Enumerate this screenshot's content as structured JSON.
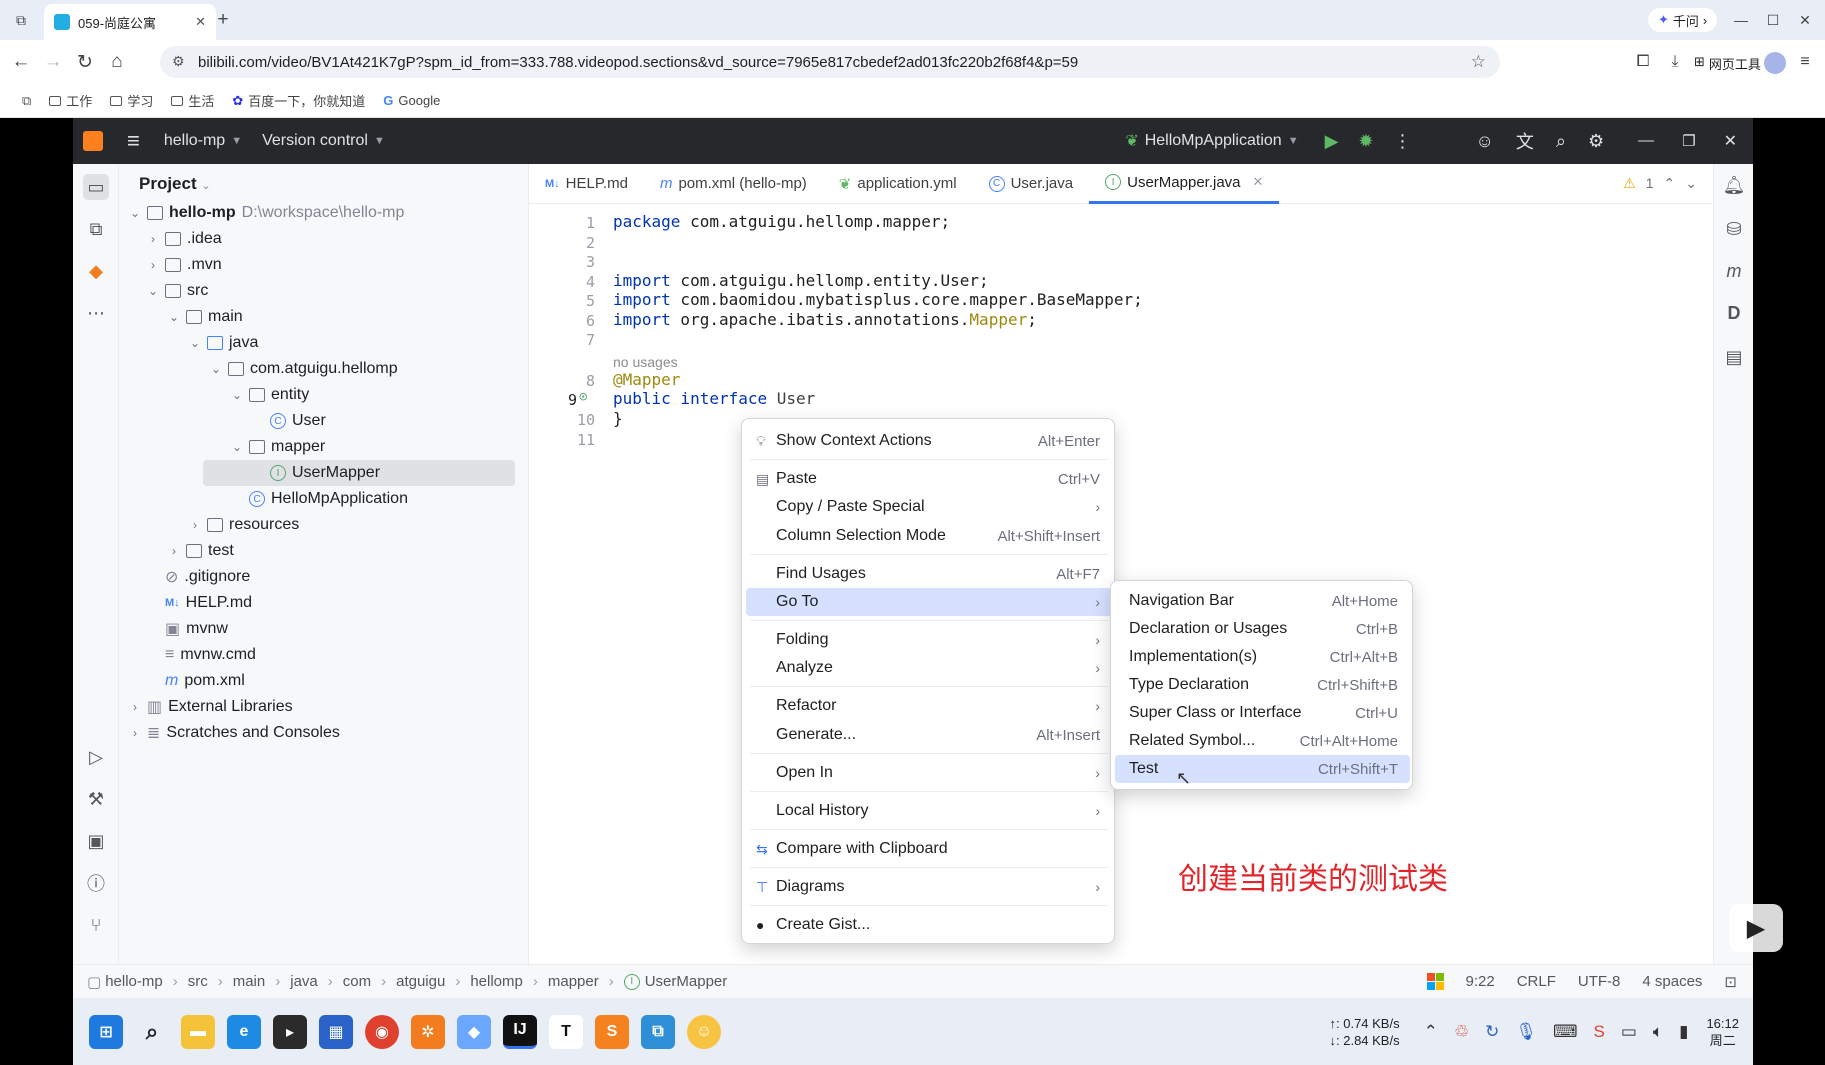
{
  "browser": {
    "tab_title": "059-尚庭公寓",
    "url": "bilibili.com/video/BV1At421K7gP?spm_id_from=333.788.videopod.sections&vd_source=7965e817cbedef2ad013fc220b2f68f4&p=59",
    "qianwen_label": "千问",
    "web_tools_label": "网页工具",
    "bookmarks": [
      "工作",
      "学习",
      "生活",
      "百度一下，你就知道",
      "Google"
    ]
  },
  "ide": {
    "project_name": "hello-mp",
    "version_control": "Version control",
    "run_config": "HelloMpApplication",
    "project_panel_title": "Project",
    "tree": [
      {
        "label": "hello-mp",
        "suffix": "D:\\workspace\\hello-mp"
      },
      {
        "label": ".idea"
      },
      {
        "label": ".mvn"
      },
      {
        "label": "src"
      },
      {
        "label": "main"
      },
      {
        "label": "java"
      },
      {
        "label": "com.atguigu.hellomp"
      },
      {
        "label": "entity"
      },
      {
        "label": "User"
      },
      {
        "label": "mapper"
      },
      {
        "label": "UserMapper"
      },
      {
        "label": "HelloMpApplication"
      },
      {
        "label": "resources"
      },
      {
        "label": "test"
      },
      {
        "label": ".gitignore"
      },
      {
        "label": "HELP.md"
      },
      {
        "label": "mvnw"
      },
      {
        "label": "mvnw.cmd"
      },
      {
        "label": "pom.xml"
      },
      {
        "label": "External Libraries"
      },
      {
        "label": "Scratches and Consoles"
      }
    ],
    "editor_tabs": [
      "HELP.md",
      "pom.xml (hello-mp)",
      "application.yml",
      "User.java",
      "UserMapper.java"
    ],
    "warning_count": "1",
    "code": {
      "line1_kw": "package",
      "line1_rest": " com.atguigu.hellomp.mapper;",
      "line4_kw": "import",
      "line4_rest": " com.atguigu.hellomp.entity.User;",
      "line5_kw": "import",
      "line5_rest": " com.baomidou.mybatisplus.core.mapper.BaseMapper;",
      "line6_kw": "import",
      "line6_rest": " org.apache.ibatis.annotations.",
      "line6_ann": "Mapper",
      "line6_end": ";",
      "usages": "no usages",
      "line8": "@Mapper",
      "line9_kw": "public interface",
      "line9_rest": " User",
      "line10": "}"
    },
    "line_numbers": [
      "1",
      "2",
      "3",
      "4",
      "5",
      "6",
      "7",
      "8",
      "9",
      "10",
      "11"
    ],
    "breadcrumb": [
      "hello-mp",
      "src",
      "main",
      "java",
      "com",
      "atguigu",
      "hellomp",
      "mapper",
      "UserMapper"
    ],
    "status": {
      "position": "9:22",
      "line_sep": "CRLF",
      "encoding": "UTF-8",
      "indent": "4 spaces"
    }
  },
  "context_menu": {
    "items": [
      {
        "label": "Show Context Actions",
        "shortcut": "Alt+Enter"
      },
      {
        "label": "Paste",
        "shortcut": "Ctrl+V"
      },
      {
        "label": "Copy / Paste Special"
      },
      {
        "label": "Column Selection Mode",
        "shortcut": "Alt+Shift+Insert"
      },
      {
        "label": "Find Usages",
        "shortcut": "Alt+F7"
      },
      {
        "label": "Go To"
      },
      {
        "label": "Folding"
      },
      {
        "label": "Analyze"
      },
      {
        "label": "Refactor"
      },
      {
        "label": "Generate...",
        "shortcut": "Alt+Insert"
      },
      {
        "label": "Open In"
      },
      {
        "label": "Local History"
      },
      {
        "label": "Compare with Clipboard"
      },
      {
        "label": "Diagrams"
      },
      {
        "label": "Create Gist..."
      }
    ]
  },
  "submenu": {
    "items": [
      {
        "label": "Navigation Bar",
        "shortcut": "Alt+Home"
      },
      {
        "label": "Declaration or Usages",
        "shortcut": "Ctrl+B"
      },
      {
        "label": "Implementation(s)",
        "shortcut": "Ctrl+Alt+B"
      },
      {
        "label": "Type Declaration",
        "shortcut": "Ctrl+Shift+B"
      },
      {
        "label": "Super Class or Interface",
        "shortcut": "Ctrl+U"
      },
      {
        "label": "Related Symbol...",
        "shortcut": "Ctrl+Alt+Home"
      },
      {
        "label": "Test",
        "shortcut": "Ctrl+Shift+T"
      }
    ]
  },
  "caption": "创建当前类的测试类",
  "taskbar": {
    "net_up": "↑: 0.74 KB/s",
    "net_down": "↓: 2.84 KB/s",
    "time": "16:12",
    "day": "周二"
  }
}
